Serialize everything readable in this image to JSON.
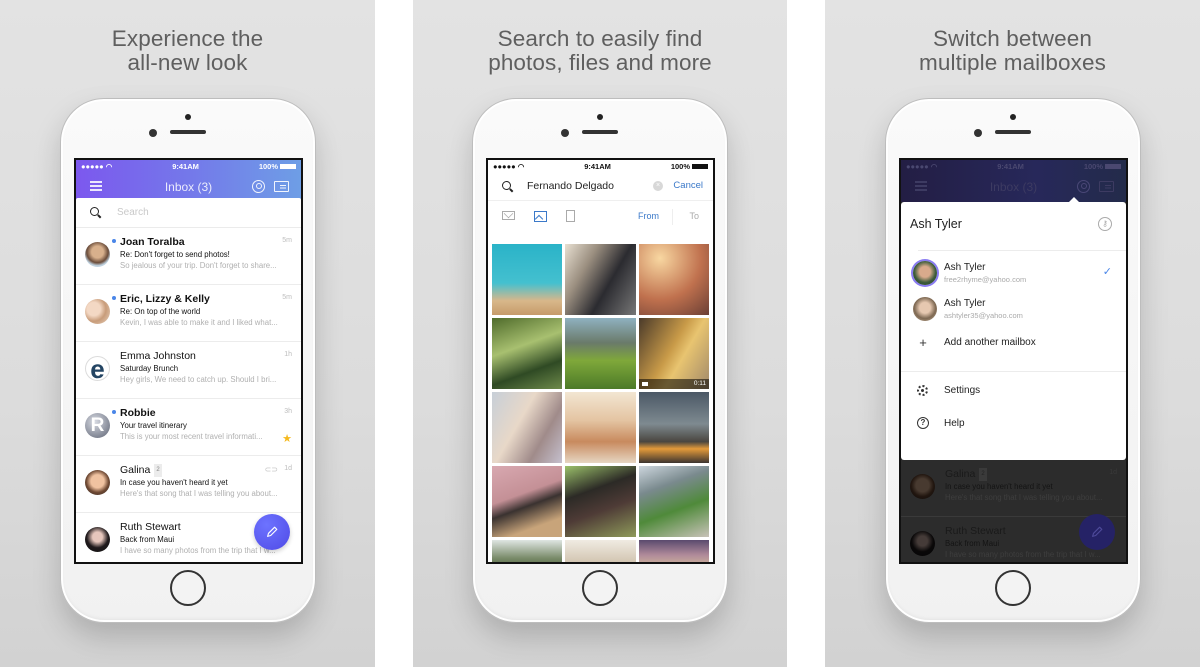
{
  "panels": [
    {
      "caption_line1": "Experience the",
      "caption_line2": "all-new look",
      "status": {
        "signal": "●●●●● ◠",
        "time": "9:41AM",
        "battery": "100%"
      },
      "header": {
        "title": "Inbox (3)",
        "menu_icon": "hamburger-icon",
        "account_icon": "account-icon",
        "news_icon": "newsfeed-icon"
      },
      "search": {
        "placeholder": "Search"
      },
      "emails": [
        {
          "from": "Joan Toralba",
          "subject": "Re: Don't forget to send photos!",
          "snippet": "So jealous of your trip. Don't forget to share...",
          "time": "5m",
          "unread": true
        },
        {
          "from": "Eric, Lizzy & Kelly",
          "subject": "Re: On top of the world",
          "snippet": "Kevin, I was able to make it and I liked what...",
          "time": "5m",
          "unread": true
        },
        {
          "from": "Emma Johnston",
          "subject": "Saturday Brunch",
          "snippet": "Hey girls, We need to catch up. Should I bri...",
          "time": "1h",
          "unread": false,
          "avatar_letter": "e"
        },
        {
          "from": "Robbie",
          "subject": "Your travel itinerary",
          "snippet": "This is your most recent travel informati...",
          "time": "3h",
          "unread": true,
          "avatar_letter": "R",
          "starred": true
        },
        {
          "from": "Galina",
          "thread_count": "2",
          "subject": "In case you haven't heard it yet",
          "snippet": "Here's that song that I was telling you about...",
          "time": "1d",
          "unread": false,
          "attachment": true
        },
        {
          "from": "Ruth Stewart",
          "subject": "Back from Maui",
          "snippet": "I have so many photos from the trip that I w...",
          "time": "",
          "unread": false
        }
      ],
      "compose_icon": "pencil-icon"
    },
    {
      "caption_line1": "Search to easily find",
      "caption_line2": "photos, files and more",
      "status": {
        "signal": "●●●●● ◠",
        "time": "9:41AM",
        "battery": "100%"
      },
      "search": {
        "query": "Fernando Delgado",
        "clear": "×",
        "cancel_label": "Cancel"
      },
      "filters": {
        "from_label": "From",
        "to_label": "To",
        "active": "photos"
      },
      "video_duration": "0:11"
    },
    {
      "caption_line1": "Switch between",
      "caption_line2": "multiple mailboxes",
      "status": {
        "signal": "●●●●● ◠",
        "time": "9:41AM",
        "battery": "100%"
      },
      "header": {
        "title": "Inbox (3)"
      },
      "dropdown": {
        "title": "Ash Tyler",
        "manage_icon": "key-icon",
        "accounts": [
          {
            "name": "Ash Tyler",
            "email": "free2rhyme@yahoo.com",
            "selected": true,
            "check": "✓"
          },
          {
            "name": "Ash Tyler",
            "email": "ashtyler35@yahoo.com",
            "selected": false
          }
        ],
        "add_label": "Add another mailbox",
        "add_glyph": "+",
        "settings_label": "Settings",
        "help_label": "Help",
        "help_glyph": "?"
      },
      "emails": [
        {
          "from": "Galina",
          "thread_count": "2",
          "subject": "In case you haven't heard it yet",
          "snippet": "Here's that song that I was telling you about...",
          "time": "1d"
        },
        {
          "from": "Ruth Stewart",
          "subject": "Back from Maui",
          "snippet": "I have so many photos from the trip that I w..."
        }
      ]
    }
  ],
  "colors": {
    "accent_blue": "#3b79c9",
    "header_purple": "#7c58ee",
    "header_blue": "#6e9ee6",
    "fab": "#5a55f0",
    "star": "#f5b91d",
    "unread_dot": "#4a86e8"
  }
}
